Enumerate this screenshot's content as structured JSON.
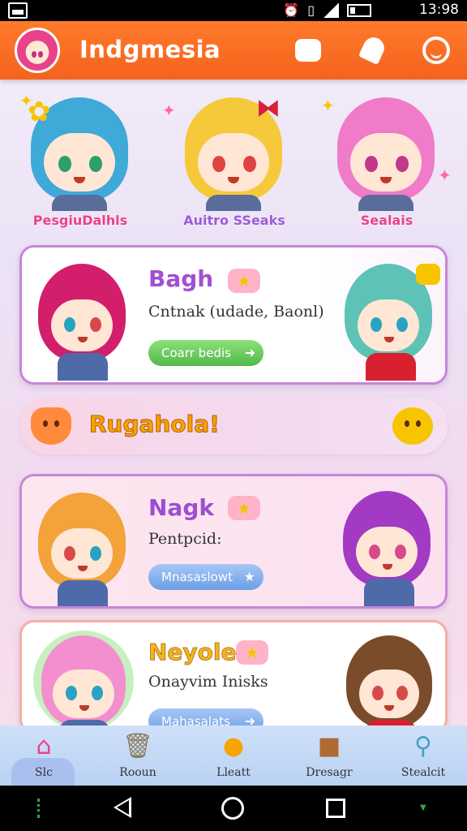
{
  "status_bar": {
    "time": "13:98",
    "icons": [
      "alarm-icon",
      "vibrate-icon",
      "signal-icon",
      "battery-icon"
    ]
  },
  "app_bar": {
    "title": "Indgmesia",
    "actions": [
      "puzzle-icon",
      "bell-icon",
      "smile-icon"
    ]
  },
  "featured": [
    {
      "name": "PesgiuDalhls",
      "hair_color": "#3fa9d8",
      "eye_color": "#2e9e6a",
      "name_color": "#e8428a"
    },
    {
      "name": "Auitro SSeaks",
      "hair_color": "#f5c93a",
      "eye_color": "#d44",
      "name_color": "#9a5ad8"
    },
    {
      "name": "Sealais",
      "hair_color": "#f07bc8",
      "eye_color": "#c0398a",
      "name_color": "#e8428a"
    }
  ],
  "cards": [
    {
      "title": "Bagh",
      "subtitle": "Cntnak (udade, Baonl)",
      "button": "Coarr bedis",
      "title_color": "#a24fd0",
      "button_style": "green",
      "left_hair": "#d21e6b",
      "right_hair": "#5fc2b7"
    },
    {
      "title": "Nagk",
      "subtitle": "Pentpcid:",
      "button": "Mnasaslowt",
      "title_color": "#9b4fd0",
      "button_style": "blue",
      "left_hair": "#f4a23a",
      "right_hair": "#a23ac4"
    },
    {
      "title": "Neyoles",
      "subtitle": "Onayvim Inisks",
      "button": "Mahasalats",
      "title_color": "#f2b51f",
      "button_style": "blue",
      "left_hair": "#f38fcf",
      "right_hair": "#7a4c2a"
    }
  ],
  "banner": {
    "text": "Rugahola!"
  },
  "bottom_nav": [
    {
      "label": "Slc",
      "icon": "house-icon",
      "active": true
    },
    {
      "label": "Rooun",
      "icon": "trash-icon",
      "active": false
    },
    {
      "label": "Lleatt",
      "icon": "cookie-icon",
      "active": false
    },
    {
      "label": "Dresagr",
      "icon": "bear-icon",
      "active": false
    },
    {
      "label": "Stealcit",
      "icon": "search-icon",
      "active": false
    }
  ]
}
